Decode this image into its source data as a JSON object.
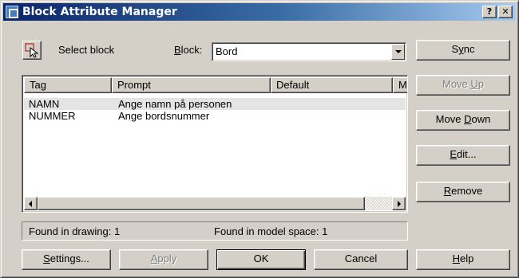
{
  "window": {
    "title": "Block Attribute Manager",
    "help_glyph": "?",
    "close_glyph": "✕"
  },
  "select_block": {
    "label": "Select block",
    "icon": "pick-cursor-icon"
  },
  "block": {
    "label_accel": "B",
    "label_rest": "lock:",
    "value": "Bord"
  },
  "attributes": {
    "columns": [
      "Tag",
      "Prompt",
      "Default",
      "Mc"
    ],
    "rows": [
      {
        "tag": "NAMN",
        "prompt": "Ange namn på personen",
        "default": "",
        "selected": true
      },
      {
        "tag": "NUMMER",
        "prompt": "Ange bordsnummer",
        "default": "",
        "selected": false
      }
    ]
  },
  "side_buttons": {
    "sync": {
      "pre": "S",
      "accel": "y",
      "post": "nc"
    },
    "move_up": {
      "pre": "Move ",
      "accel": "U",
      "post": "p",
      "enabled": false
    },
    "move_down": {
      "pre": "Move ",
      "accel": "D",
      "post": "own"
    },
    "edit": {
      "pre": "",
      "accel": "E",
      "post": "dit..."
    },
    "remove": {
      "pre": "",
      "accel": "R",
      "post": "emove"
    }
  },
  "status": {
    "found_in_drawing": "Found in drawing: 1",
    "found_in_model_space": "Found in model space: 1"
  },
  "bottom_buttons": {
    "settings": {
      "accel": "S",
      "post": "ettings..."
    },
    "apply": {
      "accel": "A",
      "post": "pply",
      "enabled": false
    },
    "ok": "OK",
    "cancel": "Cancel",
    "help": {
      "accel": "H",
      "post": "elp"
    }
  }
}
